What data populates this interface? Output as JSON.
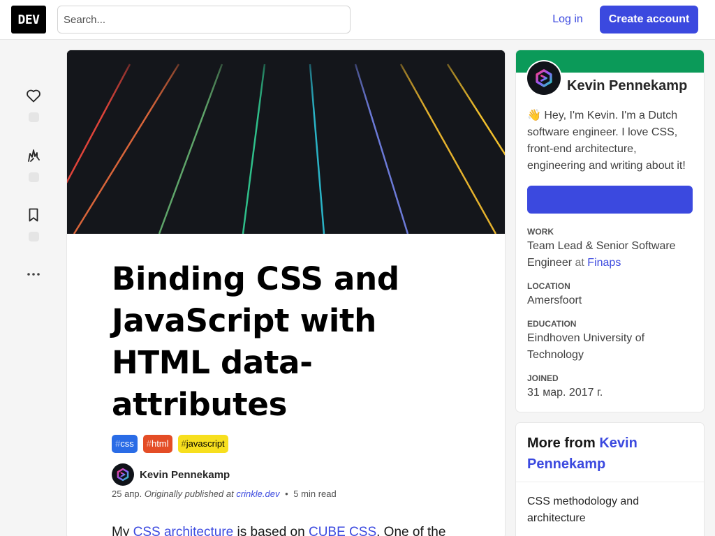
{
  "header": {
    "logo_text": "DEV",
    "search_placeholder": "Search...",
    "login_label": "Log in",
    "create_account_label": "Create account"
  },
  "reactions": {
    "heart_count": "",
    "unicorn_count": "",
    "bookmark_count": ""
  },
  "article": {
    "title": "Binding CSS and JavaScript with HTML data-attributes",
    "tags": [
      {
        "hash": "#",
        "name": "css",
        "bg": "#2a6ce6",
        "fg": "#ffffff"
      },
      {
        "hash": "#",
        "name": "html",
        "bg": "#e44d26",
        "fg": "#ffffff"
      },
      {
        "hash": "#",
        "name": "javascript",
        "bg": "#f7df1e",
        "fg": "#000000"
      }
    ],
    "author": "Kevin Pennekamp",
    "date": "25 апр.",
    "originally_published": "Originally published at",
    "source": "crinkle.dev",
    "separator": "•",
    "read_time": "5 min read",
    "body": {
      "p1_a": "My ",
      "p1_link1": "CSS architecture",
      "p1_b": " is based on ",
      "p1_link2": "CUBE CSS",
      "p1_c": ". One of the"
    }
  },
  "profile": {
    "name": "Kevin Pennekamp",
    "bio": "👋 Hey, I'm Kevin. I'm a Dutch software engineer. I love CSS, front-end architecture, engineering and writing about it!",
    "follow_label": "",
    "work_label": "WORK",
    "work_value": "Team Lead & Senior Software Engineer",
    "work_at": "at",
    "work_company": "Finaps",
    "location_label": "LOCATION",
    "location_value": "Amersfoort",
    "education_label": "EDUCATION",
    "education_value": "Eindhoven University of Technology",
    "joined_label": "JOINED",
    "joined_value": "31 мар. 2017 г.",
    "band_color": "#0b9a59"
  },
  "more_from": {
    "prefix": "More from",
    "author": "Kevin Pennekamp",
    "items": [
      "CSS methodology and architecture"
    ]
  },
  "colors": {
    "accent": "#3b49df",
    "cover_bg": "#14161b"
  }
}
